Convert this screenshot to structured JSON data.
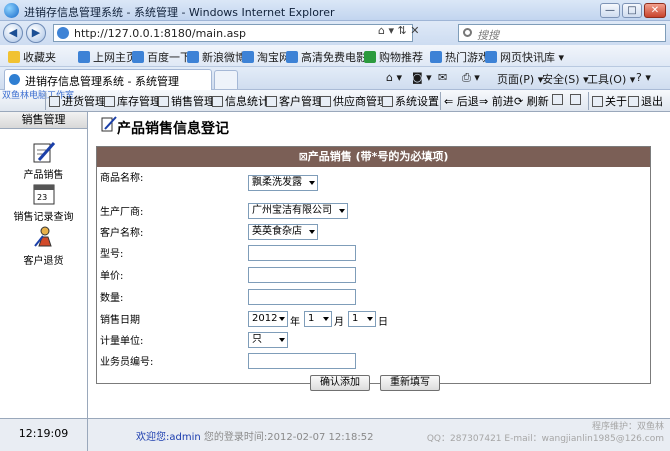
{
  "window": {
    "title": "进销存信息管理系统 - 系统管理 - Windows Internet Explorer",
    "url": "http://127.0.0.1:8180/main.asp",
    "search_placeholder": "搜搜",
    "tab_title": "进销存信息管理系统 - 系统管理"
  },
  "favorites": {
    "label": "收藏夹",
    "items": [
      "上网主页",
      "百度一下",
      "新浪微博",
      "淘宝网",
      "高清免费电影",
      "购物推荐",
      "热门游戏",
      "网页快讯库"
    ]
  },
  "ie_commands": [
    "页面(P)",
    "安全(S)",
    "工具(O)"
  ],
  "app_toolbar": {
    "logo": "双鱼林电脑工作室",
    "items": [
      "进货管理",
      "库存管理",
      "销售管理",
      "信息统计",
      "客户管理",
      "供应商管理",
      "系统设置",
      "后退",
      "前进",
      "刷新",
      "关于",
      "退出"
    ]
  },
  "sidebar": {
    "header": "销售管理",
    "items": [
      "产品销售",
      "销售记录查询",
      "客户退货"
    ]
  },
  "page": {
    "title": "产品销售信息登记",
    "form_header": "产品销售 (带*号的为必填项)"
  },
  "form": {
    "product_label": "商品名称:",
    "product_value": "飘柔洗发露",
    "maker_label": "生产厂商:",
    "maker_value": "广州宝洁有限公司",
    "customer_label": "客户名称:",
    "customer_value": "英英食杂店",
    "model_label": "型号:",
    "price_label": "单价:",
    "qty_label": "数量:",
    "date_label": "销售日期",
    "year_value": "2012",
    "year_unit": "年",
    "month_value": "1",
    "month_unit": "月",
    "day_value": "1",
    "day_unit": "日",
    "measure_label": "计量单位:",
    "measure_value": "只",
    "staff_label": "业务员编号:",
    "submit_label": "确认添加",
    "reset_label": "重新填写"
  },
  "status": {
    "clock": "12:19:09",
    "welcome": "欢迎您:admin",
    "login_time": "您的登录时间:2012-02-07 12:18:52",
    "copyright_line1": "程序维护：双鱼林",
    "copyright_line2": "QQ：287307421 E-mail：wangjianlin1985@126.com"
  }
}
